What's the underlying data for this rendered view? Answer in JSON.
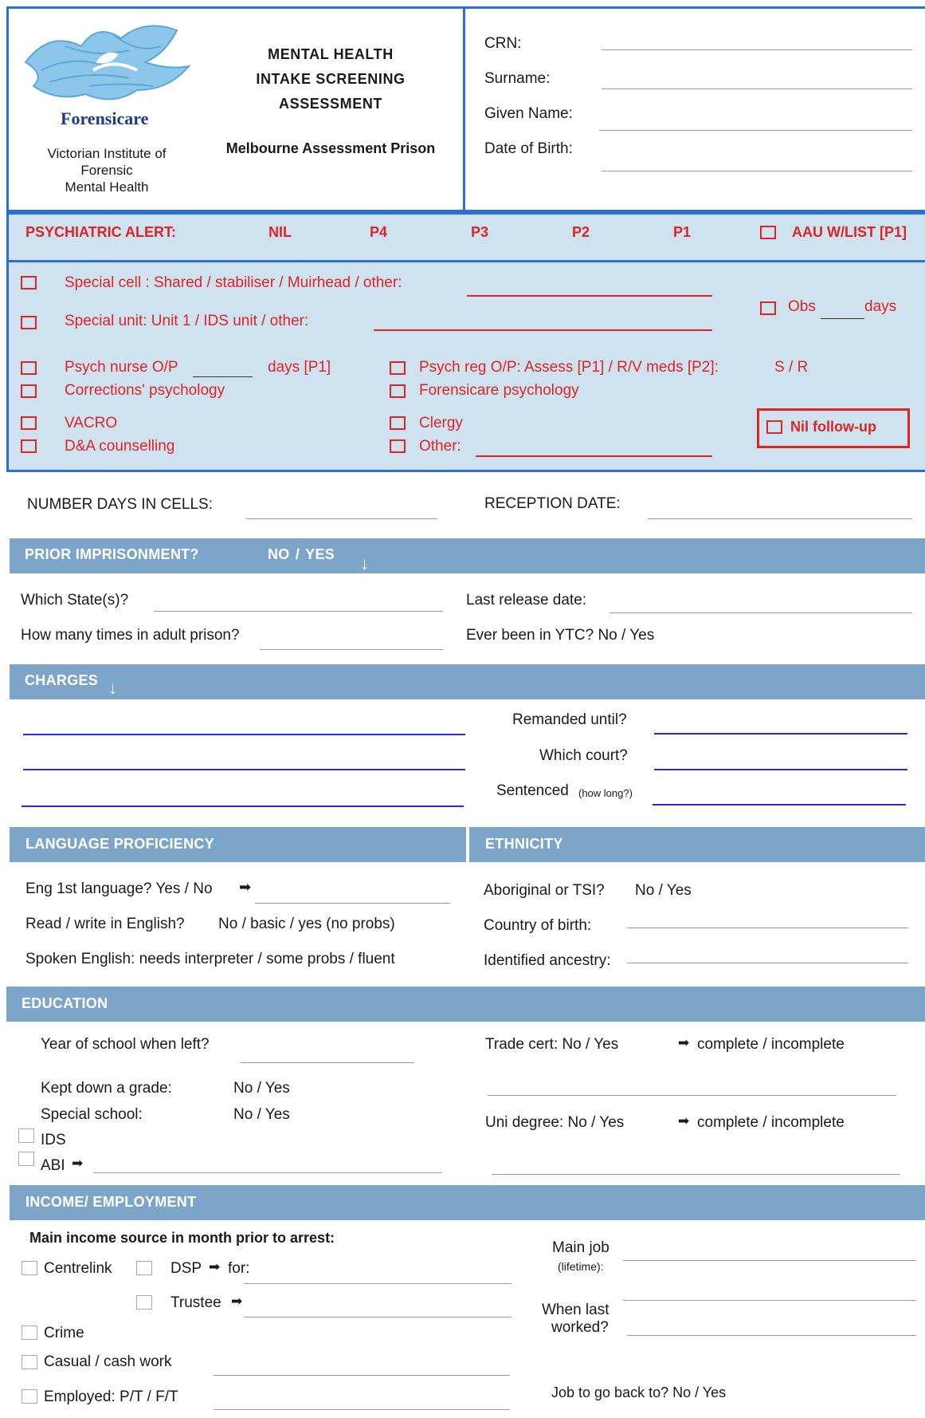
{
  "header": {
    "org_name": "Forensicare",
    "org_full": [
      "Victorian Institute of",
      "Forensic",
      "Mental Health"
    ],
    "title_lines": [
      "MENTAL HEALTH",
      "INTAKE SCREENING",
      "ASSESSMENT"
    ],
    "location": "Melbourne Assessment Prison",
    "fields": [
      "CRN:",
      "Surname:",
      "Given Name:",
      "Date of Birth:"
    ]
  },
  "alert": {
    "label": "PSYCHIATRIC ALERT:",
    "levels": [
      "NIL",
      "P4",
      "P3",
      "P2",
      "P1"
    ],
    "aau": "AAU W/LIST [P1]"
  },
  "services": {
    "special_cell": "Special cell :  Shared  /  stabiliser  /  Muirhead  /  other:",
    "special_unit": "Special unit:  Unit 1  /  IDS unit  /  other:",
    "obs": "Obs",
    "obs_days": "days",
    "psych_nurse": "Psych nurse O/P",
    "psych_nurse_days": "days [P1]",
    "corrections": "Corrections' psychology",
    "vacro": "VACRO",
    "dna": "D&A counselling",
    "psych_reg": "Psych reg O/P:  Assess [P1]  /  R/V meds [P2]:",
    "s_r": "S  /  R",
    "forensicare_psych": "Forensicare psychology",
    "clergy": "Clergy",
    "other": "Other:",
    "nil_followup": "Nil follow-up"
  },
  "reception": {
    "days_cells": "NUMBER DAYS IN CELLS:",
    "reception_date": "RECEPTION DATE:"
  },
  "prior": {
    "header": "PRIOR IMPRISONMENT?",
    "options": "NO /  YES",
    "which_states": "Which State(s)?",
    "last_release": "Last release date:",
    "how_many": "How many times in adult prison?",
    "ytc": "Ever  been in YTC?  No /   Yes"
  },
  "charges": {
    "header": "CHARGES",
    "remanded": "Remanded until?",
    "which_court": "Which court?",
    "sentenced": "Sentenced",
    "sentenced_note": "(how long?)"
  },
  "language": {
    "header": "LANGUAGE PROFICIENCY",
    "eng_first": "Eng 1st language?  Yes /  No",
    "read_write": "Read / write in English?",
    "read_write_opts": "No /  basic  / yes (no probs)",
    "spoken": "Spoken English:  needs interpreter  /  some probs  /  fluent"
  },
  "ethnicity": {
    "header": "ETHNICITY",
    "aboriginal": "Aboriginal or TSI?",
    "aboriginal_opts": "No /  Yes",
    "country": "Country of birth:",
    "ancestry": "Identified ancestry:"
  },
  "education": {
    "header": "EDUCATION",
    "year_left": "Year of school when left?",
    "kept_down": "Kept down a grade:",
    "kept_down_opts": "No  / Yes",
    "special_school": "Special school:",
    "special_school_opts": "No  /  Yes",
    "ids": "IDS",
    "abi": "ABI",
    "trade_cert": "Trade cert:  No  /   Yes",
    "uni_degree": "Uni degree:  No  /   Yes",
    "complete": "complete  /  incomplete"
  },
  "income": {
    "header": "INCOME/ EMPLOYMENT",
    "main_source": "Main income source in month prior to arrest:",
    "centrelink": "Centrelink",
    "dsp": "DSP",
    "dsp_for": "for:",
    "trustee": "Trustee",
    "crime": "Crime",
    "casual": "Casual  /  cash work",
    "employed": "Employed:  P/T  /  F/T",
    "main_job": "Main job",
    "main_job_note": "(lifetime):",
    "when_last": [
      "When last",
      "worked?"
    ],
    "job_back": "Job to go back to?  No  /  Yes"
  },
  "colors": {
    "band": "#7da5c9",
    "alert_bg": "#cfe2f0",
    "border": "#2a6fd6",
    "red": "#e02424",
    "field_blue": "#2230c8"
  }
}
